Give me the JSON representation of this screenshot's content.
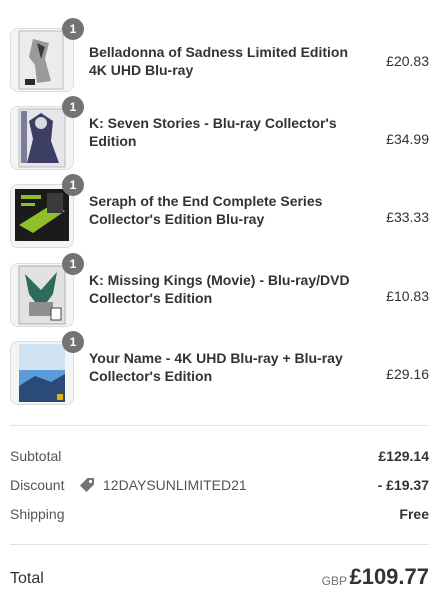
{
  "cart": {
    "items": [
      {
        "title": "Belladonna of Sadness Limited Edition 4K UHD Blu-ray",
        "price": "£20.83",
        "quantity": "1",
        "thumb_colors": [
          "#f2f2f2",
          "#9a9a9a",
          "#2c2c2c"
        ]
      },
      {
        "title": "K: Seven Stories - Blu-ray Collector's Edition",
        "price": "£34.99",
        "quantity": "1",
        "thumb_colors": [
          "#e8e8ec",
          "#3c3e64",
          "#b5b7c8"
        ]
      },
      {
        "title": "Seraph of the End Complete Series Collector's Edition Blu-ray",
        "price": "£33.33",
        "quantity": "1",
        "thumb_colors": [
          "#1b1b1b",
          "#8fbf2a",
          "#3b3b3b"
        ]
      },
      {
        "title": "K: Missing Kings (Movie) - Blu-ray/DVD Collector's Edition",
        "price": "£10.83",
        "quantity": "1",
        "thumb_colors": [
          "#e0e0e0",
          "#2e6b5e",
          "#8f8f8f"
        ]
      },
      {
        "title": "Your Name - 4K UHD Blu-ray + Blu-ray Collector's Edition",
        "price": "£29.16",
        "quantity": "1",
        "thumb_colors": [
          "#5b9bd8",
          "#cfe3f2",
          "#2a4a7a"
        ]
      }
    ]
  },
  "summary": {
    "subtotal_label": "Subtotal",
    "subtotal_value": "£129.14",
    "discount_label": "Discount",
    "discount_code": "12DAYSUNLIMITED21",
    "discount_icon": "tag-icon",
    "discount_value": "- £19.37",
    "shipping_label": "Shipping",
    "shipping_value": "Free"
  },
  "total": {
    "label": "Total",
    "currency": "GBP",
    "amount": "£109.77"
  }
}
